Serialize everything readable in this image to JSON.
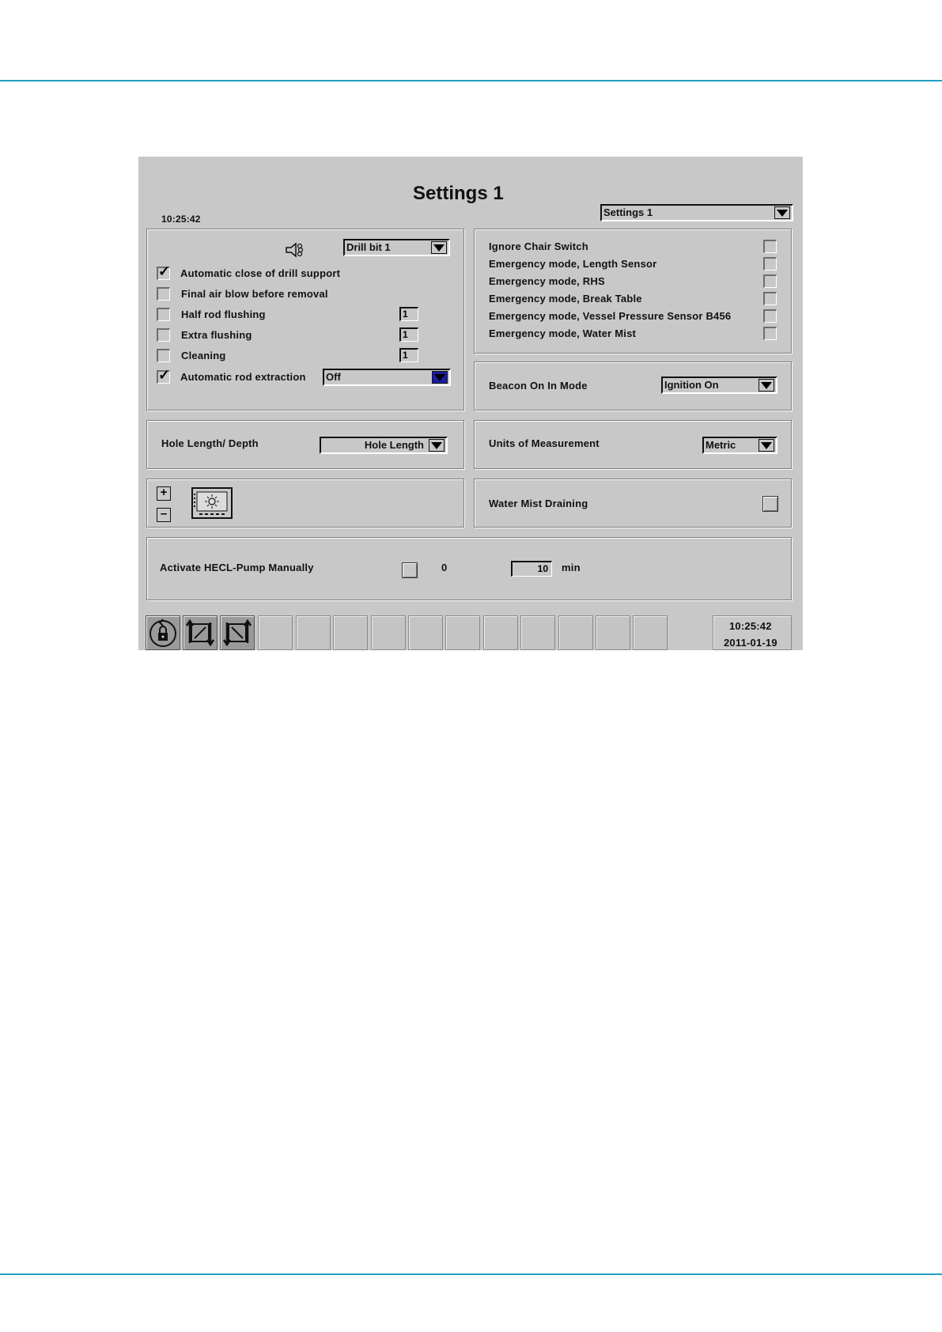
{
  "header": {
    "title": "Settings 1",
    "time": "10:25:42"
  },
  "page_select": {
    "value": "Settings 1"
  },
  "drill_panel": {
    "drill_bit_select": "Drill bit 1",
    "rows": [
      {
        "label": "Automatic close of drill support",
        "checked": true
      },
      {
        "label": "Final air blow before removal",
        "checked": false
      },
      {
        "label": "Half rod flushing",
        "checked": false,
        "value": "1"
      },
      {
        "label": "Extra flushing",
        "checked": false,
        "value": "1"
      },
      {
        "label": "Cleaning",
        "checked": false,
        "value": "1"
      },
      {
        "label": "Automatic rod extraction",
        "checked": true,
        "select": "Off"
      }
    ]
  },
  "emergency_panel": {
    "rows": [
      {
        "label": "Ignore Chair Switch",
        "checked": false
      },
      {
        "label": "Emergency mode, Length Sensor",
        "checked": false
      },
      {
        "label": "Emergency mode, RHS",
        "checked": false
      },
      {
        "label": "Emergency mode, Break Table",
        "checked": false
      },
      {
        "label": "Emergency mode, Vessel Pressure Sensor B456",
        "checked": false
      },
      {
        "label": "Emergency mode, Water Mist",
        "checked": false
      }
    ]
  },
  "beacon": {
    "label": "Beacon On In Mode",
    "value": "Ignition On"
  },
  "hole": {
    "label": "Hole Length/ Depth",
    "value": "Hole Length"
  },
  "units": {
    "label": "Units of Measurement",
    "value": "Metric"
  },
  "brightness": {
    "plus": "+",
    "minus": "–"
  },
  "water_mist": {
    "label": "Water Mist Draining"
  },
  "hecl": {
    "label": "Activate HECL-Pump Manually",
    "state": "0",
    "minutes": "10",
    "unit": "min"
  },
  "footer": {
    "time": "10:25:42",
    "date": "2011-01-19"
  },
  "icons": [
    "speaker-icon",
    "lock-icon",
    "swap-icon-1",
    "swap-icon-2",
    "screen-brightness-icon"
  ]
}
